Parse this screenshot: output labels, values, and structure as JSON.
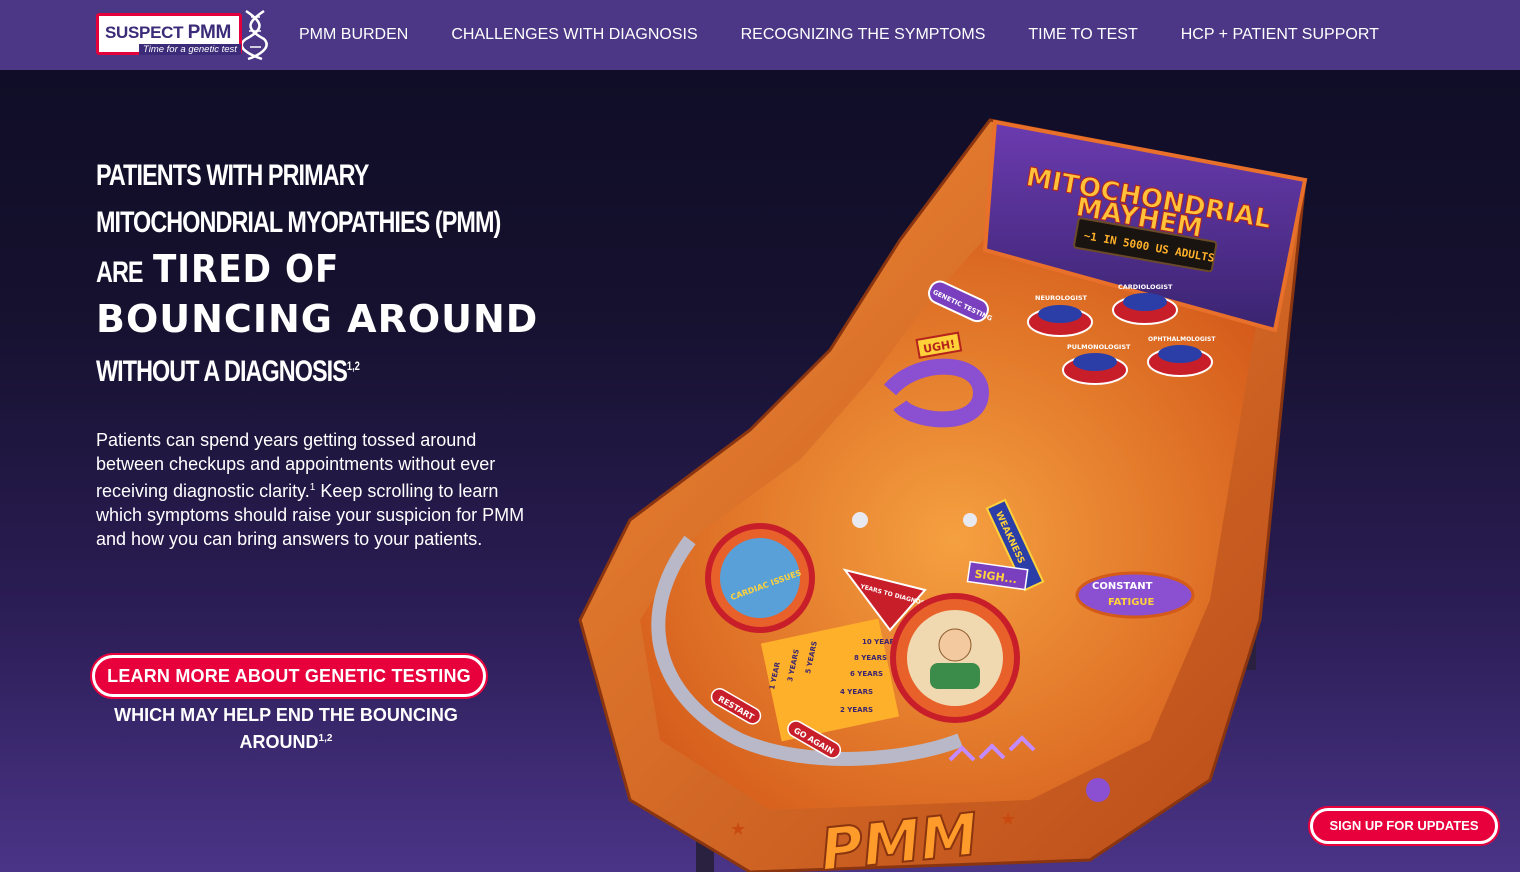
{
  "logo": {
    "word_a": "SUSPECT",
    "word_b": "PMM",
    "tagline": "Time for a genetic test"
  },
  "nav": {
    "items": [
      {
        "label": "PMM BURDEN"
      },
      {
        "label": "CHALLENGES WITH DIAGNOSIS"
      },
      {
        "label": "RECOGNIZING THE SYMPTOMS"
      },
      {
        "label": "TIME TO TEST"
      },
      {
        "label": "HCP + PATIENT SUPPORT"
      }
    ]
  },
  "hero": {
    "line1": "Patients with primary",
    "line2": "mitochondrial myopathies (PMM)",
    "line3_prefix": "are",
    "line3_big": "TIRED OF",
    "line4_big": "BOUNCING AROUND",
    "line5": "without a diagnosis",
    "line5_sup": "1,2"
  },
  "body": {
    "part1": "Patients can spend years getting tossed around between checkups and appointments without ever receiving diagnostic clarity.",
    "sup": "1",
    "part2": " Keep scrolling to learn which symptoms should raise your suspicion for PMM and how you can bring answers to your patients."
  },
  "cta": {
    "label": "LEARN MORE ABOUT GENETIC TESTING",
    "sub": "WHICH MAY HELP END THE BOUNCING AROUND",
    "sub_sup": "1,2"
  },
  "signup": {
    "label": "SIGN UP FOR UPDATES"
  },
  "art": {
    "backglass_title_1": "MITOCHONDRIAL",
    "backglass_title_2": "MAYHEM",
    "display_text": "~1 IN 5000 US ADULTS",
    "genetic_testing": "GENETIC TESTING",
    "bumpers": [
      "NEUROLOGIST",
      "CARDIOLOGIST",
      "PULMONOLOGIST",
      "OPHTHALMOLOGIST"
    ],
    "ugh": "UGH!",
    "weakness": "WEAKNESS",
    "sigh": "SIGH...",
    "constant_fatigue_1": "CONSTANT",
    "constant_fatigue_2": "FATIGUE",
    "cardiac": "CARDIAC ISSUES",
    "years_to_diagnosis": "YEARS TO DIAGNOSIS",
    "years": [
      "1 YEAR",
      "2 YEARS",
      "3 YEARS",
      "4 YEARS",
      "5 YEARS",
      "6 YEARS",
      "8 YEARS",
      "10 YEARS"
    ],
    "restart": "RESTART",
    "go_again": "GO AGAIN",
    "cabinet_logo": "PMM"
  },
  "colors": {
    "nav_bg": "#4b3786",
    "accent_red": "#e8003d",
    "logo_purple": "#3b2b78",
    "cabinet_orange": "#e8702a",
    "playfield_purple": "#7a3fbf"
  }
}
